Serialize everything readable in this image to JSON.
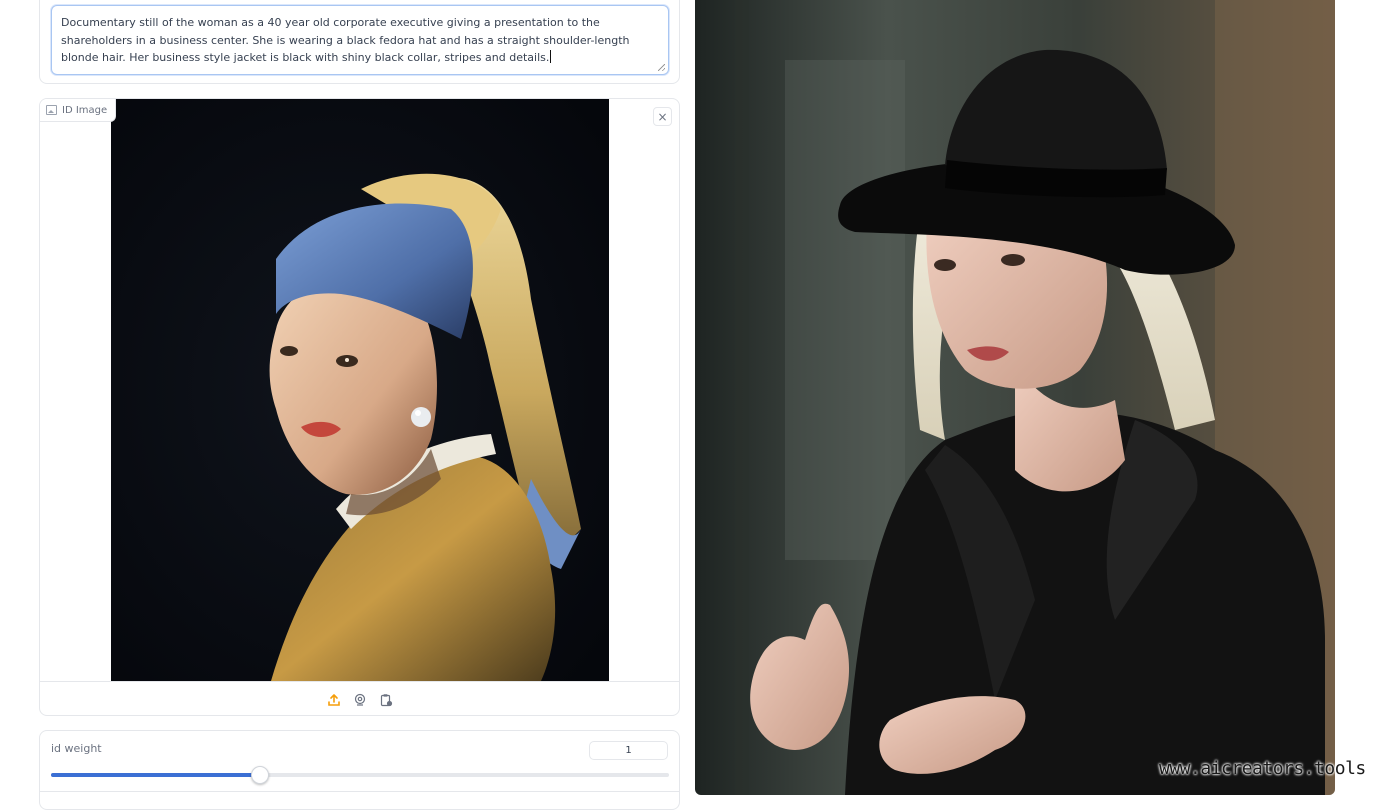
{
  "prompt": {
    "text": "Documentary still of the woman as a 40 year old corporate executive giving a presentation to the shareholders in a business center. She is wearing a black fedora hat and has a straight shoulder-length blonde hair. Her business style jacket is black with shiny black collar, stripes and details."
  },
  "id_image": {
    "label": "ID Image",
    "label_icon": "image-icon",
    "close_icon": "close-icon",
    "close_symbol": "×",
    "toolbar_icons": [
      "upload-icon",
      "webcam-icon",
      "clipboard-paste-icon"
    ],
    "accent_color": "#f59e0b"
  },
  "id_weight": {
    "label": "id weight",
    "value": "1",
    "fraction": 0.337,
    "fill_color": "#3b6fd4"
  },
  "watermark": "www.aicreators.tools"
}
